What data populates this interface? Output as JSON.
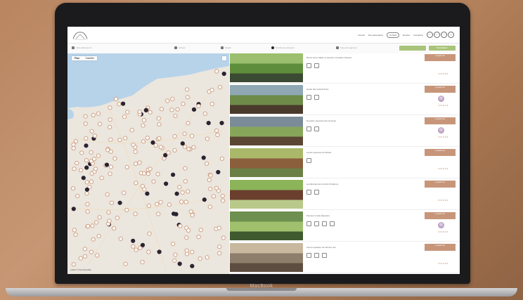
{
  "device": {
    "brand_label": "MacBook"
  },
  "header": {
    "nav": [
      "Accueil",
      "Nos partenaires",
      "Contact",
      "Ecuries",
      "Inscription"
    ],
    "active_nav_index": 2,
    "social": [
      "f",
      "t",
      "i",
      "y"
    ]
  },
  "filters": {
    "location_placeholder": "Votre adresse ici",
    "arrival_placeholder": "Arrivée",
    "departure_placeholder": "Départ",
    "horses_placeholder": "Nombre de chevaux",
    "type_placeholder": "Type de logement",
    "search_button": "",
    "reset_button": "Réinitialiser"
  },
  "map": {
    "toggle": [
      "Plan",
      "Satellite"
    ],
    "active_toggle": 0,
    "attribution": "Leaflet | © OpenStreetMap",
    "water_color": "#b7d3ea",
    "land_color": "#ebe6de",
    "marker_color": "#d0a184",
    "marker_dark_color": "#2b2330"
  },
  "listings": [
    {
      "title": "Écurie de la Vallée et pension complète chevaux",
      "price": "à partir de",
      "rating": "★★★★★",
      "amenities": 2,
      "badge": false
    },
    {
      "title": "Haras des Grands Prés",
      "price": "à partir de",
      "rating": "★★★★★",
      "amenities": 2,
      "badge": true
    },
    {
      "title": "Domaine équestre des Sources",
      "price": "à partir de",
      "rating": "★★★★★",
      "amenities": 2,
      "badge": true
    },
    {
      "title": "Centre équestre du Moulin",
      "price": "à partir de",
      "rating": "★★★★★",
      "amenities": 1,
      "badge": false
    },
    {
      "title": "Les Écuries de la Forêt d'Ardenne",
      "price": "à partir de",
      "rating": "★★★★★",
      "amenities": 2,
      "badge": false
    },
    {
      "title": "Pension & Gîte Équestre",
      "price": "à partir de",
      "rating": "★★★★★",
      "amenities": 4,
      "badge": true
    },
    {
      "title": "Ferme équestre du Val de Loire",
      "price": "à partir de",
      "rating": "★★★★★",
      "amenities": 3,
      "badge": false
    }
  ],
  "accent_color": "#c7967a",
  "green_color": "#a9c47a"
}
